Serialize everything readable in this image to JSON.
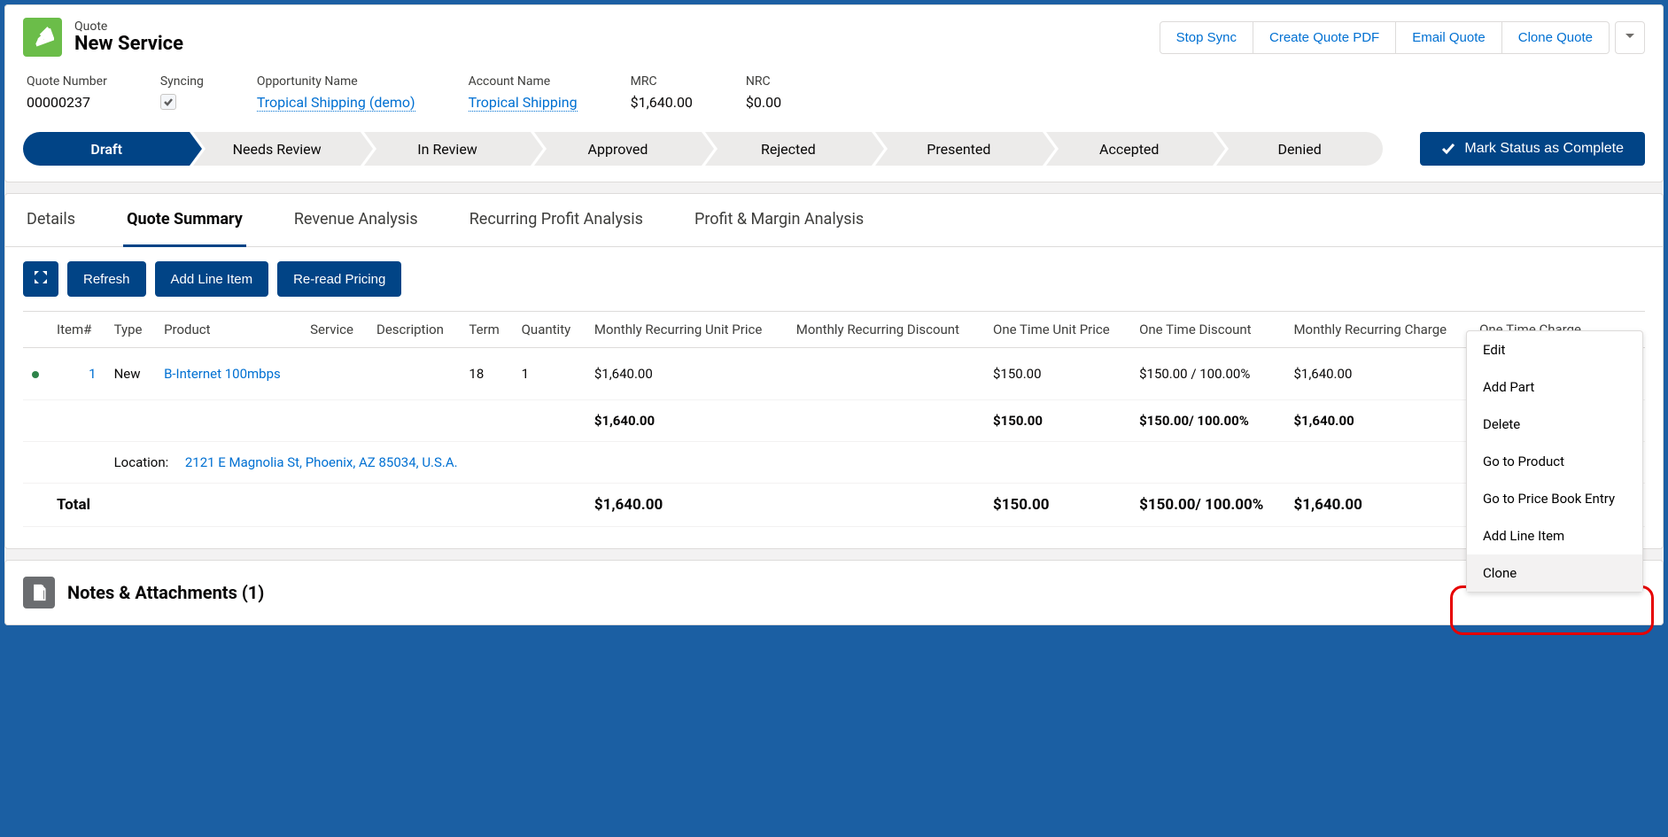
{
  "header": {
    "object_label": "Quote",
    "title": "New Service",
    "actions": {
      "stop_sync": "Stop Sync",
      "create_pdf": "Create Quote PDF",
      "email_quote": "Email Quote",
      "clone_quote": "Clone Quote"
    }
  },
  "fields": {
    "quote_number": {
      "label": "Quote Number",
      "value": "00000237"
    },
    "syncing": {
      "label": "Syncing",
      "checked": true
    },
    "opportunity": {
      "label": "Opportunity Name",
      "value": "Tropical Shipping (demo)"
    },
    "account": {
      "label": "Account Name",
      "value": "Tropical Shipping"
    },
    "mrc": {
      "label": "MRC",
      "value": "$1,640.00"
    },
    "nrc": {
      "label": "NRC",
      "value": "$0.00"
    }
  },
  "path": {
    "stages": [
      "Draft",
      "Needs Review",
      "In Review",
      "Approved",
      "Rejected",
      "Presented",
      "Accepted",
      "Denied"
    ],
    "current": "Draft",
    "mark_complete": "Mark Status as Complete"
  },
  "tabs": {
    "items": [
      "Details",
      "Quote Summary",
      "Revenue Analysis",
      "Recurring Profit Analysis",
      "Profit & Margin Analysis"
    ],
    "active": "Quote Summary"
  },
  "toolbar": {
    "refresh": "Refresh",
    "add_line": "Add Line Item",
    "reread": "Re-read Pricing"
  },
  "table": {
    "columns": [
      "",
      "Item#",
      "Type",
      "Product",
      "Service",
      "Description",
      "Term",
      "Quantity",
      "Monthly Recurring Unit Price",
      "Monthly Recurring Discount",
      "One Time Unit Price",
      "One Time Discount",
      "Monthly Recurring Charge",
      "One Time Charge",
      ""
    ],
    "row": {
      "item": "1",
      "type": "New",
      "product": "B-Internet 100mbps",
      "service": "",
      "description": "",
      "term": "18",
      "quantity": "1",
      "mru_price": "$1,640.00",
      "mr_discount": "",
      "otu_price": "$150.00",
      "ot_discount": "$150.00 / 100.00%",
      "mr_charge": "$1,640.00",
      "ot_charge": ""
    },
    "subtotal": {
      "mru_price": "$1,640.00",
      "otu_price": "$150.00",
      "ot_discount": "$150.00/ 100.00%",
      "mr_charge": "$1,640.00"
    },
    "location_label": "Location:",
    "location_value": "2121 E Magnolia St, Phoenix, AZ 85034, U.S.A.",
    "total_label": "Total",
    "total": {
      "mru_price": "$1,640.00",
      "otu_price": "$150.00",
      "ot_discount": "$150.00/ 100.00%",
      "mr_charge": "$1,640.00"
    }
  },
  "row_menu": {
    "edit": "Edit",
    "add_part": "Add Part",
    "delete": "Delete",
    "go_product": "Go to Product",
    "go_pricebook": "Go to Price Book Entry",
    "add_line_item": "Add Line Item",
    "clone": "Clone"
  },
  "notes": {
    "title": "Notes & Attachments (1)"
  }
}
